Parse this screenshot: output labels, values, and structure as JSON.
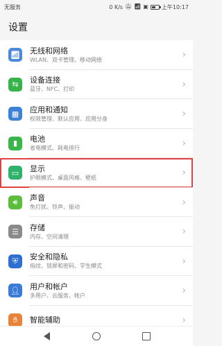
{
  "status_bar": {
    "carrier": "无服务",
    "speed": "0 K/s",
    "battery_text": "",
    "battery_level": 0.6,
    "time": "上午10:17"
  },
  "page": {
    "title": "设置"
  },
  "settings": [
    {
      "title": "无线和网络",
      "subtitle": "WLAN、双卡管理、移动网络",
      "icon": "network-icon",
      "color": "#4a89dc"
    },
    {
      "title": "设备连接",
      "subtitle": "蓝牙、NFC、打印",
      "icon": "device-connect-icon",
      "color": "#37b34a"
    },
    {
      "title": "应用和通知",
      "subtitle": "权限管理、默认应用、应用分身",
      "icon": "apps-icon",
      "color": "#3b82d6"
    },
    {
      "title": "电池",
      "subtitle": "省电模式、耗电排行",
      "icon": "battery-icon",
      "color": "#39b54a"
    },
    {
      "title": "显示",
      "subtitle": "护眼模式、桌面风格、壁纸",
      "icon": "display-icon",
      "color": "#2fb36b"
    },
    {
      "title": "声音",
      "subtitle": "免打扰、铃声、振动",
      "icon": "sound-icon",
      "color": "#5bbd3a"
    },
    {
      "title": "存储",
      "subtitle": "内存、空间清理",
      "icon": "storage-icon",
      "color": "#8a8a8a"
    },
    {
      "title": "安全和隐私",
      "subtitle": "指纹、锁屏和密码、学生模式",
      "icon": "security-icon",
      "color": "#2f6fd1"
    },
    {
      "title": "用户和帐户",
      "subtitle": "多用户、云服务、帐户",
      "icon": "user-icon",
      "color": "#3a7bd5"
    },
    {
      "title": "智能辅助",
      "subtitle": "",
      "icon": "assist-icon",
      "color": "#e8843a"
    }
  ],
  "highlight_index": 4
}
